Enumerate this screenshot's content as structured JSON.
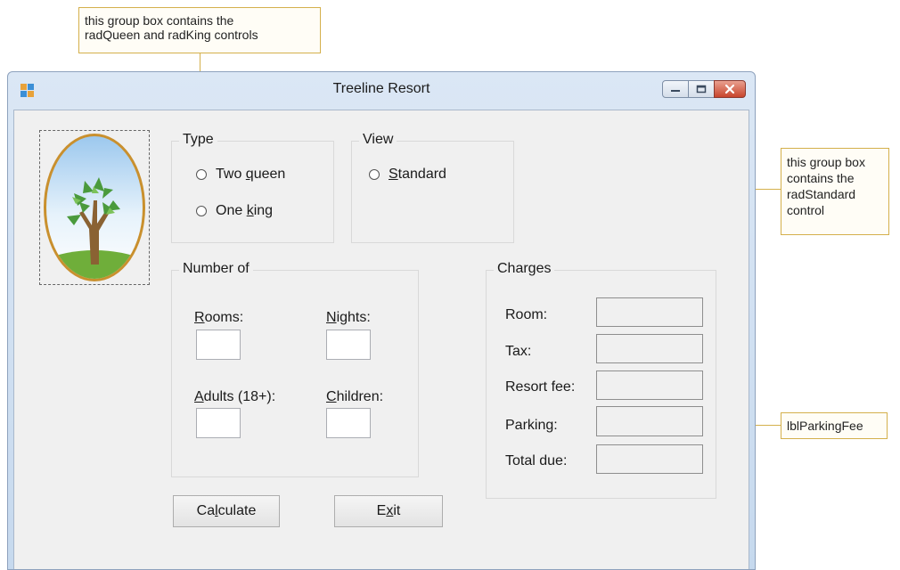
{
  "callouts": {
    "group_type": {
      "line1": "this group box contains the",
      "line2": "radQueen and radKing controls"
    },
    "group_view": {
      "line1": "this group box",
      "line2": "contains the",
      "line3": "radStandard",
      "line4": "control"
    },
    "parking": {
      "text": "lblParkingFee"
    }
  },
  "window": {
    "title": "Treeline Resort",
    "icon": "windows-form-icon",
    "controls": {
      "minimize": "minimize-icon",
      "maximize": "maximize-icon",
      "close": "close-icon"
    }
  },
  "picture": {
    "icon": "tree-icon"
  },
  "type_group": {
    "label": "Type",
    "options": [
      {
        "pre": "Two ",
        "key": "q",
        "post": "ueen"
      },
      {
        "pre": "One ",
        "key": "k",
        "post": "ing"
      }
    ]
  },
  "view_group": {
    "label": "View",
    "options": [
      {
        "pre": "",
        "key": "S",
        "post": "tandard"
      }
    ]
  },
  "number_group": {
    "label": "Number of",
    "rooms": {
      "pre": "",
      "key": "R",
      "post": "ooms:"
    },
    "nights": {
      "pre": "",
      "key": "N",
      "post": "ights:"
    },
    "adults": {
      "pre": "",
      "key": "A",
      "post": "dults (18+):"
    },
    "children": {
      "pre": "",
      "key": "C",
      "post": "hildren:"
    }
  },
  "charges_group": {
    "label": "Charges",
    "rows": [
      "Room:",
      "Tax:",
      "Resort fee:",
      "Parking:",
      "Total due:"
    ]
  },
  "buttons": {
    "calculate": {
      "pre": "Ca",
      "key": "l",
      "post": "culate"
    },
    "exit": {
      "pre": "E",
      "key": "x",
      "post": "it"
    }
  },
  "colors": {
    "callout_border": "#d4b04c",
    "titlebar": "#cfdff1",
    "close_button": "#c8452d"
  }
}
